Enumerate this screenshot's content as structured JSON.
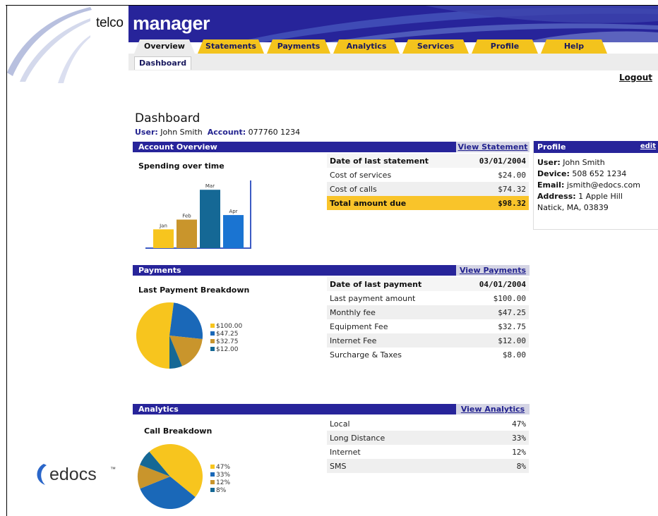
{
  "header": {
    "brand_prefix": "telco",
    "brand_name": "manager",
    "tabs": [
      {
        "label": "Overview",
        "active": true
      },
      {
        "label": "Statements",
        "active": false
      },
      {
        "label": "Payments",
        "active": false
      },
      {
        "label": "Analytics",
        "active": false
      },
      {
        "label": "Services",
        "active": false
      },
      {
        "label": "Profile",
        "active": false
      },
      {
        "label": "Help",
        "active": false
      }
    ],
    "subtab": "Dashboard",
    "logout": "Logout"
  },
  "page": {
    "title": "Dashboard",
    "user_label": "User:",
    "user_value": "John Smith",
    "account_label": "Account:",
    "account_value": "077760 1234"
  },
  "account_overview": {
    "title": "Account Overview",
    "link": "View Statement",
    "chart_title": "Spending over time",
    "rows": [
      {
        "label": "Date of last statement",
        "value": "03/01/2004"
      },
      {
        "label": "Cost of services",
        "value": "$24.00"
      },
      {
        "label": "Cost of calls",
        "value": "$74.32"
      },
      {
        "label": "Total amount due",
        "value": "$98.32"
      }
    ]
  },
  "payments": {
    "title": "Payments",
    "link": "View Payments",
    "chart_title": "Last Payment Breakdown",
    "rows": [
      {
        "label": "Date of last payment",
        "value": "04/01/2004"
      },
      {
        "label": "Last payment amount",
        "value": "$100.00"
      },
      {
        "label": "Monthly fee",
        "value": "$47.25"
      },
      {
        "label": "Equipment Fee",
        "value": "$32.75"
      },
      {
        "label": "Internet Fee",
        "value": "$12.00"
      },
      {
        "label": "Surcharge & Taxes",
        "value": "$8.00"
      }
    ]
  },
  "analytics": {
    "title": "Analytics",
    "link": "View Analytics",
    "chart_title": "Call Breakdown",
    "rows": [
      {
        "label": "Local",
        "value": "47%"
      },
      {
        "label": "Long Distance",
        "value": "33%"
      },
      {
        "label": "Internet",
        "value": "12%"
      },
      {
        "label": "SMS",
        "value": "8%"
      }
    ]
  },
  "profile": {
    "title": "Profile",
    "edit": "edit",
    "user_label": "User:",
    "user_value": "John Smith",
    "device_label": "Device:",
    "device_value": "508 652 1234",
    "email_label": "Email:",
    "email_value": "jsmith@edocs.com",
    "address_label": "Address:",
    "address_line1": "1 Apple Hill",
    "address_line2": "Natick, MA, 03839"
  },
  "footer_logo": "edocs",
  "colors": {
    "navy": "#27249a",
    "gold": "#f3c31d",
    "yellow": "#f7c51e",
    "blue": "#1a68b8",
    "ochre": "#c9952c",
    "teal": "#156895"
  },
  "chart_data": [
    {
      "type": "bar",
      "categories": [
        "Jan",
        "Feb",
        "Mar",
        "Apr"
      ],
      "values": [
        29,
        44,
        90,
        51
      ],
      "colors": [
        "#f7c51e",
        "#c9952c",
        "#156895",
        "#1a74d2"
      ],
      "ylim": [
        0,
        100
      ]
    },
    {
      "type": "pie",
      "labels": [
        "$100.00",
        "$47.25",
        "$32.75",
        "$12.00"
      ],
      "values": [
        100.0,
        47.25,
        32.75,
        12.0
      ],
      "colors": [
        "#f7c51e",
        "#1a68b8",
        "#c9952c",
        "#156895"
      ]
    },
    {
      "type": "pie",
      "labels": [
        "47%",
        "33%",
        "12%",
        "8%"
      ],
      "values": [
        47,
        33,
        12,
        8
      ],
      "colors": [
        "#f7c51e",
        "#1a68b8",
        "#c9952c",
        "#156895"
      ]
    }
  ]
}
